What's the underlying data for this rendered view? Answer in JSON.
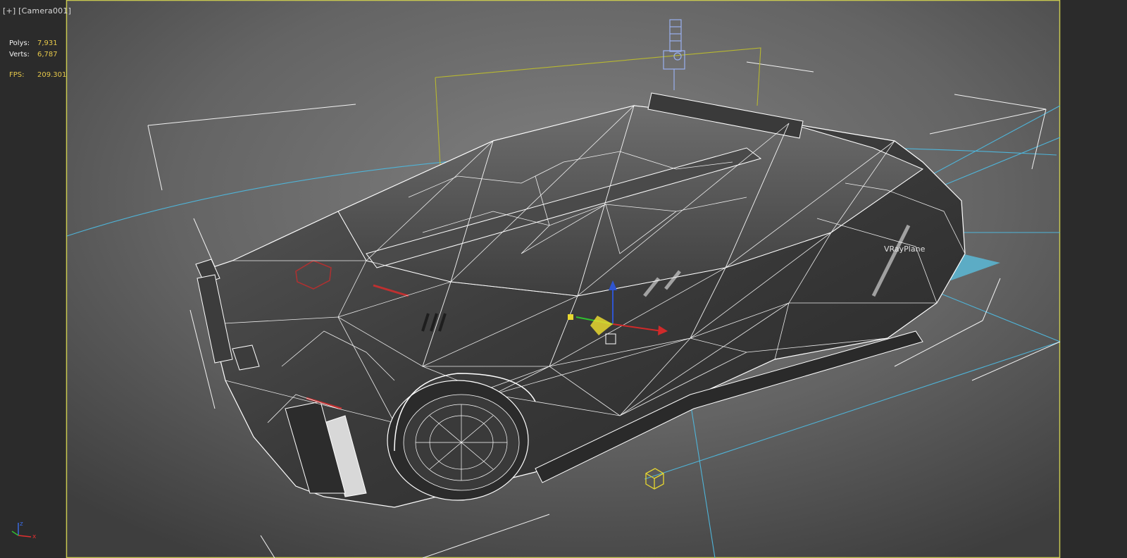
{
  "viewport": {
    "plus_label": "[+]",
    "camera_label": "[Camera001]",
    "stats": {
      "polys_label": "Polys:",
      "polys_value": "7,931",
      "verts_label": "Verts:",
      "verts_value": "6,787",
      "fps_label": "FPS:",
      "fps_value": "209.301"
    },
    "object_label": "VRayPlane",
    "axis": {
      "x": "x",
      "z": "z"
    }
  },
  "colors": {
    "viewport_border": "#c8c850",
    "selection_box": "#b8b830",
    "light_lines": "#4fb4d8",
    "vray_plane_fill": "#5ab8d6",
    "wireframe": "#ffffff",
    "stat_value": "#e6c84a"
  },
  "icons": {
    "camera": "camera-icon",
    "light_cube": "light-cube-icon",
    "gizmo": "transform-gizmo-icon",
    "axis_tripod": "axis-tripod-icon"
  }
}
